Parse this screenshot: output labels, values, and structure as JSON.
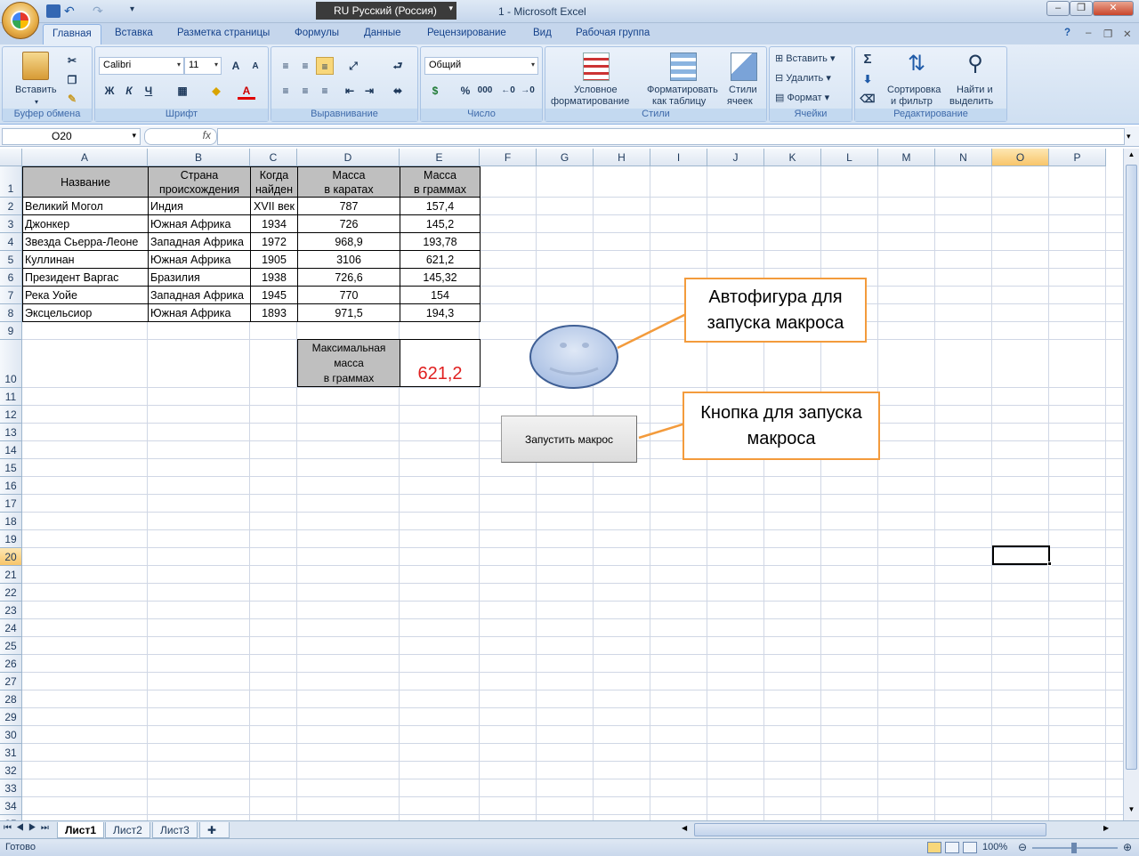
{
  "window": {
    "title": "1 - Microsoft Excel",
    "language_indicator": "RU Русский (Россия)",
    "minimize": "–",
    "restore": "❐",
    "close": "✕"
  },
  "ribbon_tabs": [
    "Главная",
    "Вставка",
    "Разметка страницы",
    "Формулы",
    "Данные",
    "Рецензирование",
    "Вид",
    "Рабочая группа"
  ],
  "clipboard": {
    "paste_label": "Вставить",
    "group_label": "Буфер обмена"
  },
  "font": {
    "name": "Calibri",
    "size": "11",
    "bold": "Ж",
    "italic": "К",
    "underline": "Ч",
    "group_label": "Шрифт"
  },
  "alignment": {
    "group_label": "Выравнивание"
  },
  "number": {
    "format": "Общий",
    "percent": "%",
    "thousands": "000",
    "group_label": "Число"
  },
  "styles": {
    "conditional": [
      "Условное",
      "форматирование"
    ],
    "as_table": [
      "Форматировать",
      "как таблицу"
    ],
    "cell_styles": [
      "Стили",
      "ячеек"
    ],
    "group_label": "Стили"
  },
  "cells": {
    "insert": "Вставить",
    "delete": "Удалить",
    "format": "Формат",
    "group_label": "Ячейки"
  },
  "editing": {
    "sort": [
      "Сортировка",
      "и фильтр"
    ],
    "find": [
      "Найти и",
      "выделить"
    ],
    "group_label": "Редактирование"
  },
  "formula_bar": {
    "name_box": "O20",
    "fx": "fx",
    "formula": ""
  },
  "columns": [
    "A",
    "B",
    "C",
    "D",
    "E",
    "F",
    "G",
    "H",
    "I",
    "J",
    "K",
    "L",
    "M",
    "N",
    "O",
    "P"
  ],
  "selected_column": "O",
  "selected_row": "20",
  "table": {
    "headers": [
      [
        "Название"
      ],
      [
        "Страна",
        "происхождения"
      ],
      [
        "Когда",
        "найден"
      ],
      [
        "Масса",
        "в каратах"
      ],
      [
        "Масса",
        "в граммах"
      ]
    ],
    "rows": [
      [
        "Великий Могол",
        "Индия",
        "XVII век",
        "787",
        "157,4"
      ],
      [
        "Джонкер",
        "Южная Африка",
        "1934",
        "726",
        "145,2"
      ],
      [
        "Звезда Сьерра-Леоне",
        "Западная Африка",
        "1972",
        "968,9",
        "193,78"
      ],
      [
        "Куллинан",
        "Южная Африка",
        "1905",
        "3106",
        "621,2"
      ],
      [
        "Президент Варгас",
        "Бразилия",
        "1938",
        "726,6",
        "145,32"
      ],
      [
        "Река Уойе",
        "Западная Африка",
        "1945",
        "770",
        "154"
      ],
      [
        "Эксцельсиор",
        "Южная Африка",
        "1893",
        "971,5",
        "194,3"
      ]
    ],
    "max_label": [
      "Максимальная",
      "масса",
      "в граммах"
    ],
    "max_value": "621,2",
    "max_value_color": "#e02020"
  },
  "callouts": {
    "autoshape": [
      "Автофигура для",
      "запуска макроса"
    ],
    "button": [
      "Кнопка для запуска",
      "макроса"
    ],
    "border_color": "#f39b3c"
  },
  "macro_button": {
    "label": "Запустить макрос"
  },
  "sheet_tabs": [
    "Лист1",
    "Лист2",
    "Лист3"
  ],
  "status": {
    "ready": "Готово",
    "zoom": "100%"
  }
}
